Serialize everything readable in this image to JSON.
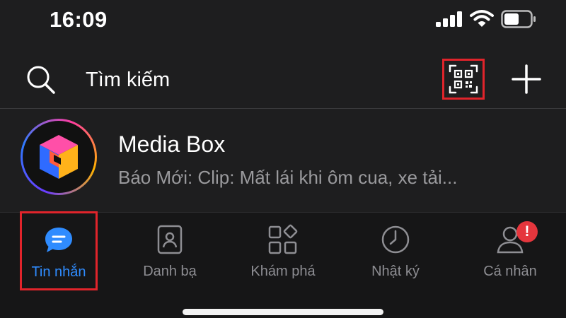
{
  "status_bar": {
    "time": "16:09"
  },
  "header": {
    "search_placeholder": "Tìm kiếm"
  },
  "chats": [
    {
      "name": "Media Box",
      "preview": "Báo Mới: Clip: Mất lái khi ôm cua, xe tải..."
    }
  ],
  "bottom_nav": {
    "items": [
      {
        "label": "Tin nhắn",
        "active": true
      },
      {
        "label": "Danh bạ"
      },
      {
        "label": "Khám phá"
      },
      {
        "label": "Nhật ký"
      },
      {
        "label": "Cá nhân"
      }
    ],
    "profile_badge": "!"
  },
  "colors": {
    "background": "#1e1e1f",
    "accent_blue": "#2f8cff",
    "highlight_red": "#e1242b",
    "muted_text": "#9a9a9d"
  },
  "icons": [
    "search-icon",
    "qr-code-icon",
    "plus-icon",
    "messages-icon",
    "contacts-icon",
    "discover-icon",
    "clock-icon",
    "user-icon"
  ]
}
